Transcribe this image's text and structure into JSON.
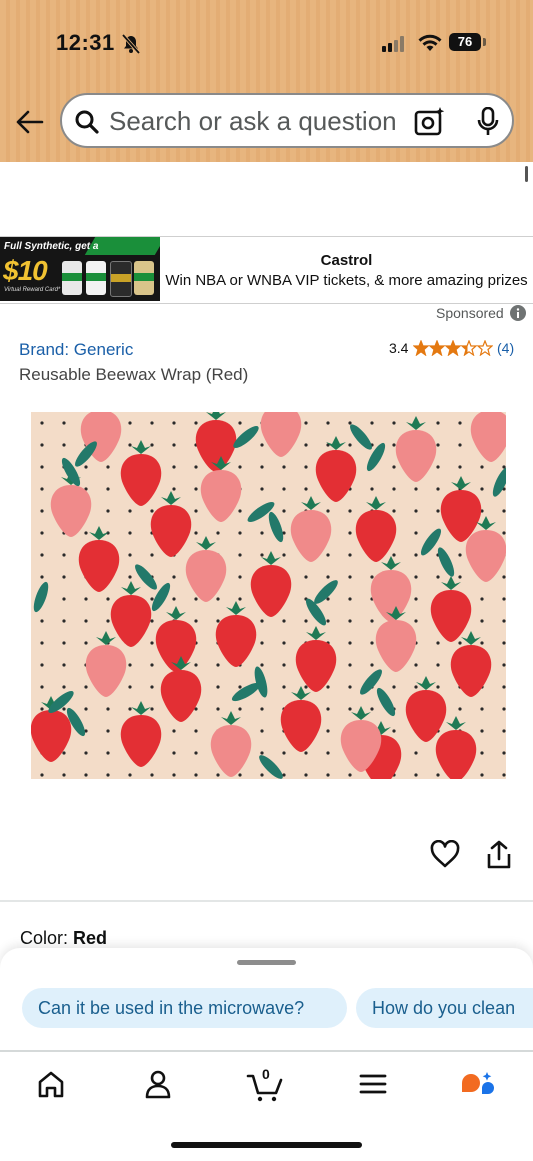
{
  "status_bar": {
    "time": "12:31",
    "battery": "76"
  },
  "search": {
    "placeholder": "Search or ask a question"
  },
  "ad": {
    "image_headline": "Full Synthetic, get a",
    "image_price": "$10",
    "image_footer": "Virtual Reward Card*",
    "brand": "Castrol",
    "tagline": "Win NBA or WNBA VIP tickets, & more amazing prizes",
    "sponsored_label": "Sponsored"
  },
  "product": {
    "brand_label": "Brand: Generic",
    "title": "Reusable Beewax Wrap (Red)",
    "rating": "3.4",
    "rating_stars": 3.4,
    "rating_count": "(4)",
    "color_label": "Color:",
    "color_value": "Red"
  },
  "suggestions": [
    {
      "label": "Can it be used in the microwave?"
    },
    {
      "label": "How do you clean"
    }
  ],
  "cart": {
    "count": "0"
  },
  "colors": {
    "header_bg": "#e7b57e",
    "link": "#1a5fa8",
    "star": "#e47911",
    "chip_bg": "#dff0fb",
    "rufus_orange": "#f26b21",
    "rufus_blue": "#1a73e8"
  },
  "icons": [
    "back-arrow-icon",
    "search-icon",
    "camera-icon",
    "mic-icon",
    "info-icon",
    "heart-icon",
    "share-icon",
    "home-icon",
    "account-icon",
    "cart-icon",
    "menu-icon",
    "rufus-icon"
  ]
}
